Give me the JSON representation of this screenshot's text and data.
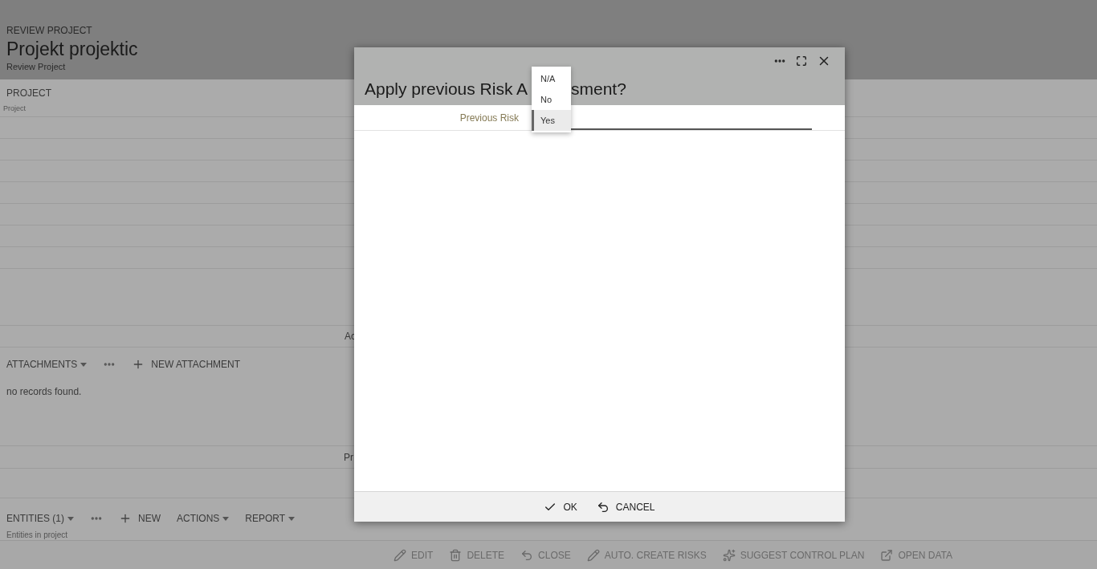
{
  "page": {
    "kicker": "REVIEW PROJECT",
    "title": "Projekt projektic",
    "subtitle": "Review Project"
  },
  "project_section": {
    "heading": "PROJECT",
    "caption": "Project"
  },
  "section_labels": [
    "Ac",
    "Pr"
  ],
  "attachments": {
    "menu": "ATTACHMENTS",
    "new": "NEW ATTACHMENT",
    "empty": "no records found."
  },
  "entities": {
    "menu": "ENTITIES (1)",
    "new": "NEW",
    "actions": "ACTIONS",
    "report": "REPORT",
    "caption": "Entities in project"
  },
  "footer_actions": [
    {
      "kind": "edit",
      "label": "EDIT"
    },
    {
      "kind": "delete",
      "label": "DELETE"
    },
    {
      "kind": "undo",
      "label": "CLOSE"
    },
    {
      "kind": "edit",
      "label": "AUTO. CREATE RISKS"
    },
    {
      "kind": "suggest",
      "label": "SUGGEST CONTROL PLAN"
    },
    {
      "kind": "open",
      "label": "OPEN DATA"
    }
  ],
  "dialog": {
    "title_parts": [
      "Apply previous Risk A",
      "sment?"
    ],
    "field_label": "Previous Risk",
    "options": [
      {
        "label": "N/A",
        "selected": false
      },
      {
        "label": "No",
        "selected": false
      },
      {
        "label": "Yes",
        "selected": true
      }
    ],
    "buttons": [
      {
        "kind": "ok",
        "label": "OK"
      },
      {
        "kind": "cancel",
        "label": "CANCEL"
      }
    ]
  }
}
